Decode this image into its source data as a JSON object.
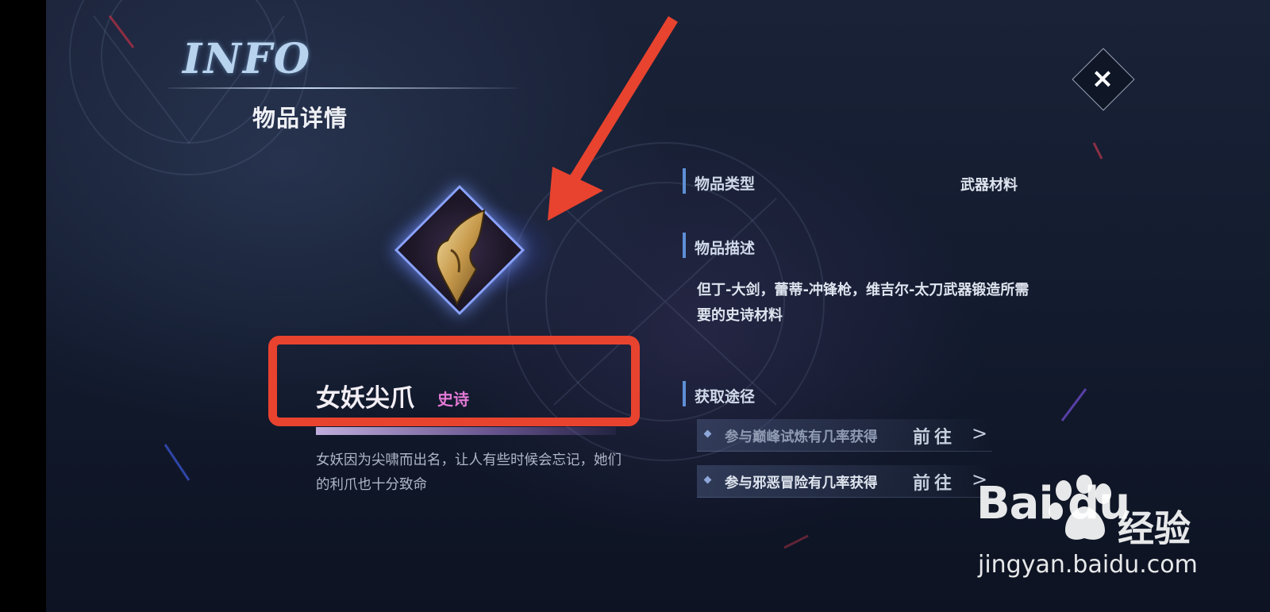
{
  "header": {
    "logo_text": "INFO",
    "title": "物品详情",
    "close_label": "×"
  },
  "item": {
    "name": "女妖尖爪",
    "rarity": "史诗",
    "flavor": "女妖因为尖啸而出名，让人有些时候会忘记，她们的利爪也十分致命",
    "icon": "claw-icon"
  },
  "details": {
    "type_label": "物品类型",
    "type_value": "武器材料",
    "desc_label": "物品描述",
    "desc_text": "但丁-大剑，蕾蒂-冲锋枪，维吉尔-太刀武器锻造所需要的史诗材料",
    "source_label": "获取途径",
    "sources": [
      {
        "text": "参与巅峰试炼有几率获得",
        "action": "前往"
      },
      {
        "text": "参与邪恶冒险有几率获得",
        "action": "前往"
      }
    ]
  },
  "annotations": {
    "arrow_color": "#e8432f",
    "highlight_color": "#e8432f"
  },
  "colors": {
    "rarity": "#e27ad5",
    "section_bar": "#5d8fd6",
    "source_text_dim": "#8f9bb3",
    "source_text": "#dfe5ef"
  },
  "watermark": {
    "brand": "Bai du",
    "product": "经验",
    "url": "jingyan.baidu.com"
  }
}
